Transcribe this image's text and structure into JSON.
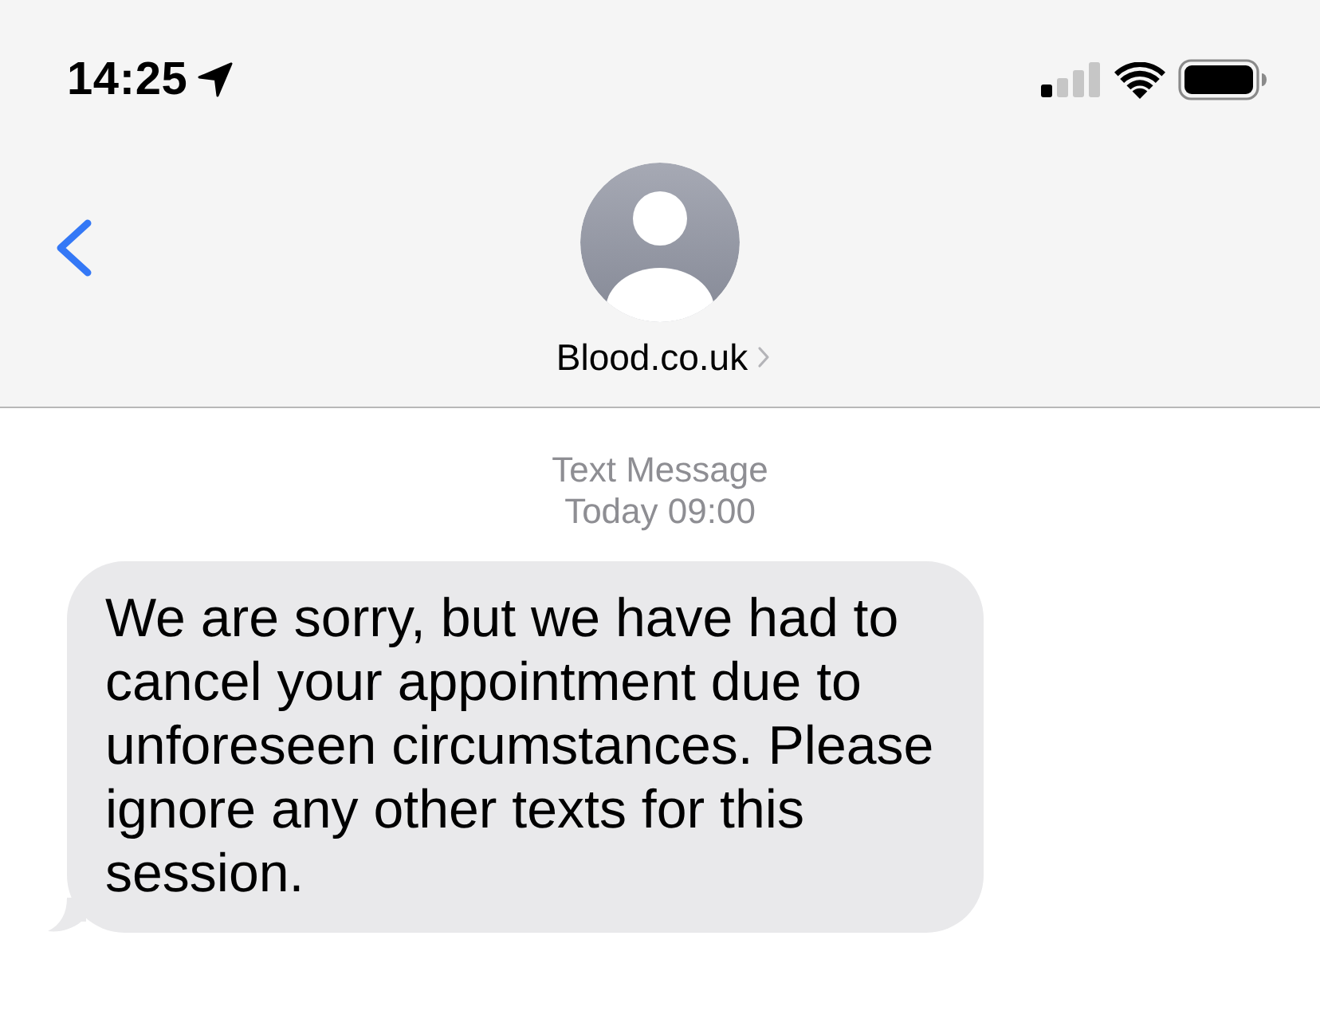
{
  "status_bar": {
    "time": "14:25"
  },
  "contact": {
    "name": "Blood.co.uk"
  },
  "thread": {
    "service": "Text Message",
    "timestamp": "Today 09:00",
    "messages": [
      {
        "kind": "incoming",
        "text": "We are sorry, but we have had to cancel your appointment due to unforeseen circumstances. Please ignore any other texts for this session."
      }
    ]
  }
}
